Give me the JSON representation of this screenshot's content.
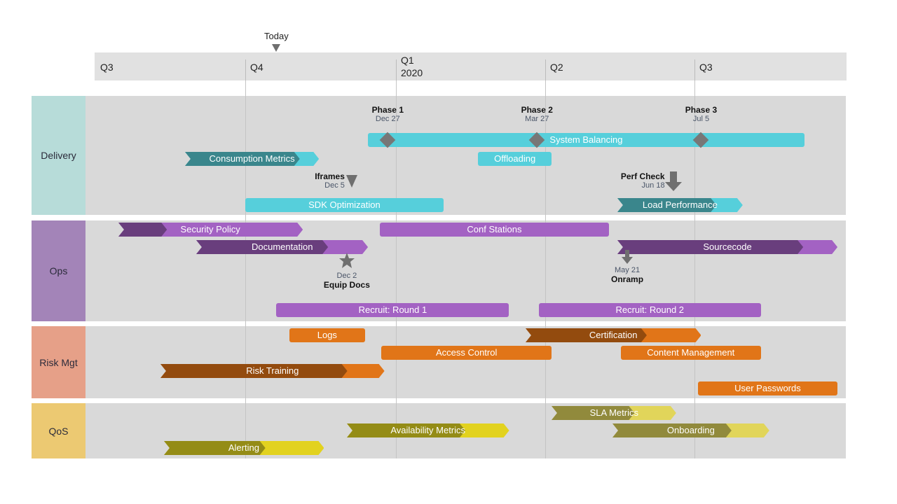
{
  "chart_data": {
    "type": "gantt",
    "timescale": {
      "quarters": [
        {
          "label": "Q3",
          "start": "2019-07-01"
        },
        {
          "label": "Q4",
          "start": "2019-10-01"
        },
        {
          "label": "Q1\n2020",
          "start": "2020-01-01"
        },
        {
          "label": "Q2",
          "start": "2020-04-01"
        },
        {
          "label": "Q3",
          "start": "2020-07-01"
        }
      ],
      "range": [
        "2019-07-01",
        "2020-09-30"
      ],
      "today": {
        "label": "Today",
        "date": "2019-10-20"
      }
    },
    "swimlanes": [
      {
        "name": "Delivery",
        "color": "#b7dcd9",
        "tasks": [
          {
            "label": "System Balancing",
            "start": "2019-12-15",
            "end": "2020-09-05",
            "row": 0,
            "style": "bar",
            "color": "#56cfdb"
          },
          {
            "label": "Consumption Metrics",
            "start": "2019-08-25",
            "end": "2019-11-15",
            "row": 1,
            "style": "chevron",
            "progress": 0.85,
            "color": "#56cfdb",
            "dark": "#3a868c"
          },
          {
            "label": "Offloading",
            "start": "2020-02-20",
            "end": "2020-04-05",
            "row": 1,
            "style": "bar",
            "color": "#56cfdb"
          },
          {
            "label": "SDK Optimization",
            "start": "2019-10-01",
            "end": "2020-01-30",
            "row": 3,
            "style": "bar",
            "color": "#56cfdb"
          },
          {
            "label": "Load Performance",
            "start": "2020-05-15",
            "end": "2020-07-30",
            "row": 3,
            "style": "chevron",
            "progress": 0.78,
            "color": "#56cfdb",
            "dark": "#3a868c"
          }
        ],
        "milestones": [
          {
            "title": "Phase 1",
            "date_label": "Dec 27",
            "date": "2019-12-27",
            "shape": "diamond",
            "label_pos": "above"
          },
          {
            "title": "Phase 2",
            "date_label": "Mar 27",
            "date": "2020-03-27",
            "shape": "diamond",
            "label_pos": "above"
          },
          {
            "title": "Phase 3",
            "date_label": "Jul 5",
            "date": "2020-07-05",
            "shape": "diamond",
            "label_pos": "above"
          },
          {
            "title": "Iframes",
            "date_label": "Dec 5",
            "date": "2019-12-05",
            "shape": "triangle-down",
            "label_pos": "left"
          },
          {
            "title": "Perf Check",
            "date_label": "Jun 18",
            "date": "2020-06-18",
            "shape": "arrow-down",
            "label_pos": "left"
          }
        ]
      },
      {
        "name": "Ops",
        "color": "#a384b8",
        "tasks": [
          {
            "label": "Security Policy",
            "start": "2019-07-15",
            "end": "2019-11-05",
            "row": 0,
            "style": "chevron",
            "progress": 0.24,
            "color": "#a362c3",
            "dark": "#693e7d"
          },
          {
            "label": "Conf Stations",
            "start": "2019-12-22",
            "end": "2020-05-10",
            "row": 0,
            "style": "bar",
            "color": "#a362c3"
          },
          {
            "label": "Documentation",
            "start": "2019-09-01",
            "end": "2019-12-15",
            "row": 1,
            "style": "chevron",
            "progress": 0.76,
            "color": "#a362c3",
            "dark": "#693e7d"
          },
          {
            "label": "Sourcecode",
            "start": "2020-05-15",
            "end": "2020-09-25",
            "row": 1,
            "style": "chevron",
            "progress": 0.84,
            "color": "#a362c3",
            "dark": "#693e7d"
          },
          {
            "label": "Recruit: Round 1",
            "start": "2019-10-20",
            "end": "2020-03-10",
            "row": 3,
            "style": "bar",
            "color": "#a362c3"
          },
          {
            "label": "Recruit: Round 2",
            "start": "2020-03-28",
            "end": "2020-08-10",
            "row": 3,
            "style": "bar",
            "color": "#a362c3"
          }
        ],
        "milestones": [
          {
            "title": "Equip Docs",
            "date_label": "Dec 2",
            "date": "2019-12-02",
            "shape": "star",
            "label_pos": "below"
          },
          {
            "title": "Onramp",
            "date_label": "May 21",
            "date": "2020-05-21",
            "shape": "arrow-down",
            "label_pos": "below"
          }
        ]
      },
      {
        "name": "Risk Mgt",
        "color": "#e6a088",
        "tasks": [
          {
            "label": "Logs",
            "start": "2019-10-28",
            "end": "2019-12-13",
            "row": 0,
            "style": "bar",
            "color": "#e17518"
          },
          {
            "label": "Certification",
            "start": "2020-03-20",
            "end": "2020-07-05",
            "row": 0,
            "style": "chevron",
            "progress": 0.68,
            "color": "#e17518",
            "dark": "#934b0e"
          },
          {
            "label": "Access Control",
            "start": "2019-12-23",
            "end": "2020-04-05",
            "row": 1,
            "style": "bar",
            "color": "#e17518"
          },
          {
            "label": "Content Management",
            "start": "2020-05-17",
            "end": "2020-08-10",
            "row": 1,
            "style": "bar",
            "color": "#e17518"
          },
          {
            "label": "Risk Training",
            "start": "2019-08-10",
            "end": "2019-12-25",
            "row": 2,
            "style": "chevron",
            "progress": 0.83,
            "color": "#e17518",
            "dark": "#934b0e"
          },
          {
            "label": "User Passwords",
            "start": "2020-07-03",
            "end": "2020-09-25",
            "row": 3,
            "style": "bar",
            "color": "#e17518"
          }
        ]
      },
      {
        "name": "QoS",
        "color": "#ecc972",
        "tasks": [
          {
            "label": "SLA Metrics",
            "start": "2020-04-05",
            "end": "2020-06-20",
            "row": 0,
            "style": "chevron",
            "progress": 0.65,
            "color": "#e1d55a",
            "dark": "#918a3c"
          },
          {
            "label": "Availability Metrics",
            "start": "2019-12-02",
            "end": "2020-03-10",
            "row": 1,
            "style": "chevron",
            "progress": 0.72,
            "color": "#e2d21f",
            "dark": "#948c16"
          },
          {
            "label": "Onboarding",
            "start": "2020-05-12",
            "end": "2020-08-15",
            "row": 1,
            "style": "chevron",
            "progress": 0.75,
            "color": "#e1d55a",
            "dark": "#918a3c"
          },
          {
            "label": "Alerting",
            "start": "2019-08-12",
            "end": "2019-11-18",
            "row": 2,
            "style": "chevron",
            "progress": 0.62,
            "color": "#e2d21f",
            "dark": "#948c16"
          }
        ]
      }
    ]
  }
}
